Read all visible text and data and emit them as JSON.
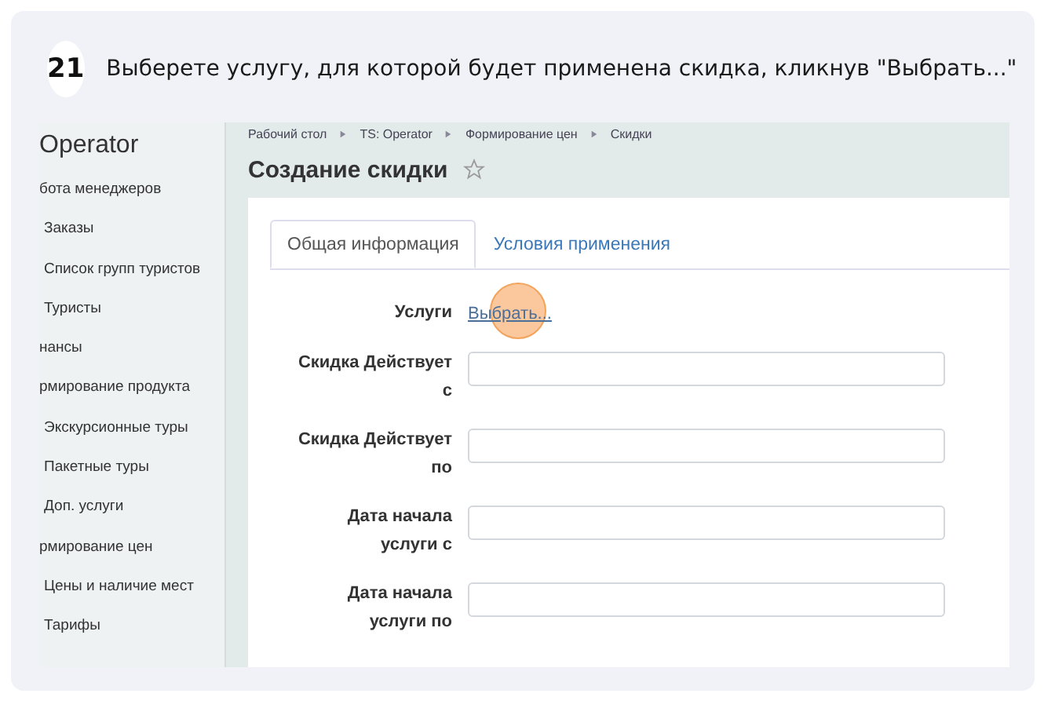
{
  "step": {
    "number": "21",
    "instruction": "Выберете услугу, для которой будет применена скидка, кликнув \"Выбрать...\""
  },
  "screenshot": {
    "sidebar": {
      "title": "Operator",
      "items": [
        {
          "label": "бота менеджеров",
          "children": [
            {
              "label": "Заказы"
            },
            {
              "label": "Список групп туристов"
            },
            {
              "label": "Туристы"
            }
          ]
        },
        {
          "label": "нансы"
        },
        {
          "label": "рмирование продукта",
          "children": [
            {
              "label": "Экскурсионные туры"
            },
            {
              "label": "Пакетные туры"
            },
            {
              "label": "Доп. услуги"
            }
          ]
        },
        {
          "label": "рмирование цен",
          "children": [
            {
              "label": "Цены и наличие мест"
            },
            {
              "label": "Тарифы"
            }
          ]
        }
      ]
    },
    "breadcrumbs": [
      "Рабочий стол",
      "TS: Operator",
      "Формирование цен",
      "Скидки"
    ],
    "page_title": "Создание скидки",
    "favorite": false,
    "tabs": [
      {
        "label": "Общая информация",
        "selected": true
      },
      {
        "label": "Условия применения",
        "selected": false
      }
    ],
    "fields": [
      {
        "kind": "link",
        "label": "Услуги",
        "link": "Выбрать...",
        "highlighted": true
      },
      {
        "kind": "input",
        "label": "Скидка Действует с"
      },
      {
        "kind": "input",
        "label": "Скидка Действует по"
      },
      {
        "kind": "input",
        "label": "Дата начала услуги с"
      },
      {
        "kind": "input",
        "label": "Дата начала услуги по"
      }
    ]
  }
}
